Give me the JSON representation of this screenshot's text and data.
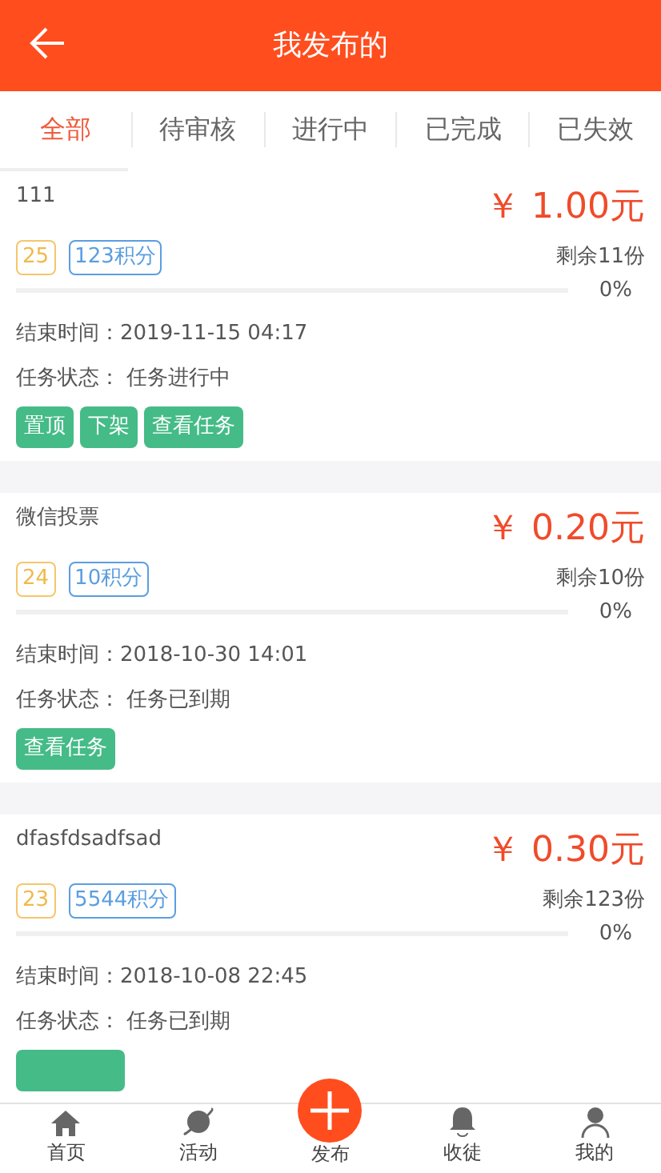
{
  "header": {
    "title": "我发布的"
  },
  "tabs": [
    {
      "label": "全部",
      "selected": true
    },
    {
      "label": "待审核",
      "selected": false
    },
    {
      "label": "进行中",
      "selected": false
    },
    {
      "label": "已完成",
      "selected": false
    },
    {
      "label": "已失效",
      "selected": false
    }
  ],
  "tasks": [
    {
      "title": "111",
      "price": "￥ 1.00元",
      "number": "25",
      "points": "123积分",
      "remaining": "剩余11份",
      "level": 0,
      "percent": "0%",
      "end_label": "结束时间：",
      "end_time": "2019-11-15 04:17",
      "status_label": "任务状态：",
      "status": "任务进行中",
      "buttons": [
        {
          "label": "置顶"
        },
        {
          "label": "下架"
        },
        {
          "label": "查看任务"
        }
      ]
    },
    {
      "title": "微信投票",
      "price": "￥ 0.20元",
      "number": "24",
      "points": "10积分",
      "remaining": "剩余10份",
      "level": 0,
      "percent": "0%",
      "end_label": "结束时间：",
      "end_time": "2018-10-30 14:01",
      "status_label": "任务状态：",
      "status": "任务已到期",
      "buttons": [
        {
          "label": "查看任务"
        }
      ]
    },
    {
      "title": "dfasfdsadfsad",
      "price": "￥ 0.30元",
      "number": "23",
      "points": "5544积分",
      "remaining": "剩余123份",
      "level": 0,
      "percent": "0%",
      "end_label": "结束时间：",
      "end_time": "2018-10-08 22:45",
      "status_label": "任务状态：",
      "status": "任务已到期",
      "buttons": [
        {
          "covered": true
        }
      ]
    }
  ],
  "bottom_nav": [
    {
      "label": "首页"
    },
    {
      "label": "活动"
    },
    {
      "label": "发布"
    },
    {
      "label": "收徒"
    },
    {
      "label": "我的"
    }
  ]
}
